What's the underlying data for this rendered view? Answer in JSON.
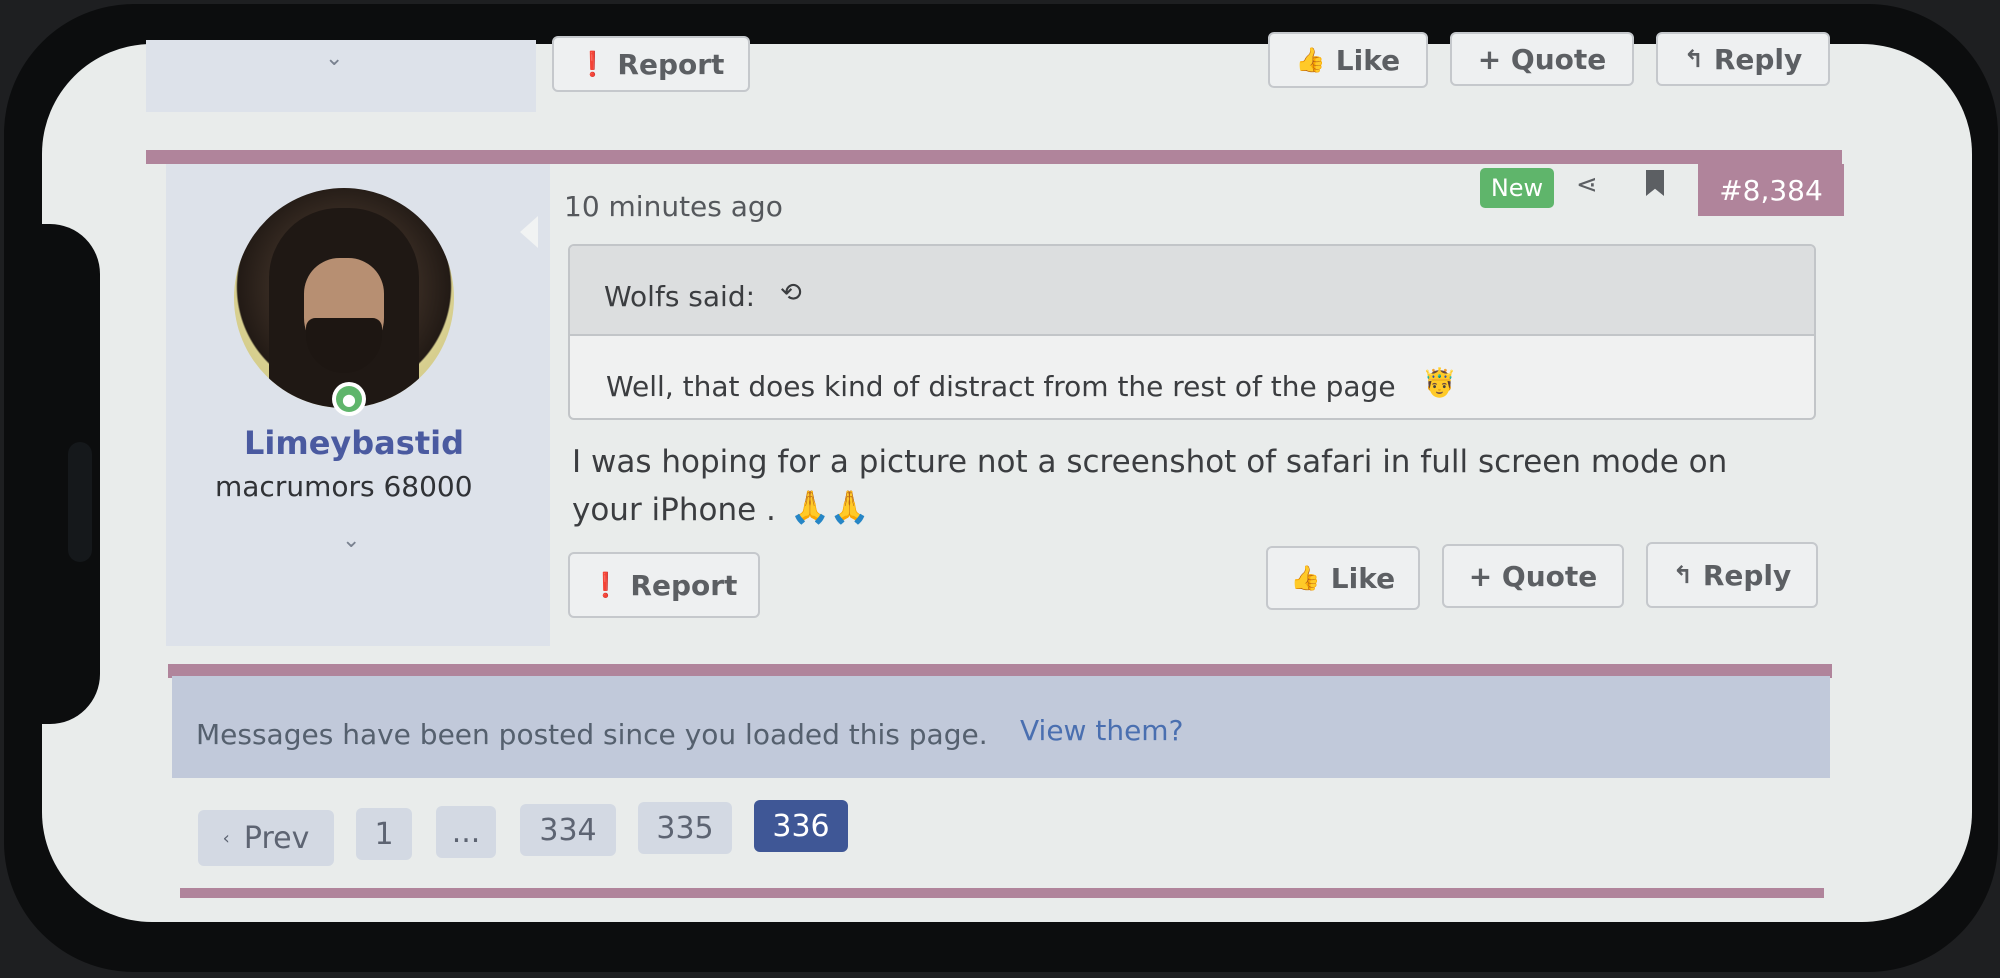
{
  "prev_post": {
    "report_label": "Report",
    "like_label": "Like",
    "quote_label": "+ Quote",
    "reply_label": "Reply"
  },
  "post": {
    "username": "Limeybastid",
    "user_title": "macrumors 68000",
    "timestamp": "10 minutes ago",
    "new_badge": "New",
    "post_number": "#8,384",
    "quote": {
      "author_line": "Wolfs said:",
      "text": "Well, that does kind of distract from the rest of the page",
      "emoji": "🤴"
    },
    "body_line1": "I was hoping for a picture not a screenshot of safari in full screen mode on",
    "body_line2": "your iPhone .",
    "body_emoji": "🙏🙏",
    "report_label": "Report",
    "like_label": "Like",
    "quote_label": "+ Quote",
    "reply_label": "Reply"
  },
  "notice": {
    "text": "Messages have been posted since you loaded this page.",
    "link": "View them?"
  },
  "pagination": {
    "prev_label": "Prev",
    "pages": [
      "1",
      "...",
      "334",
      "335",
      "336"
    ],
    "current": "336"
  },
  "colors": {
    "accent_pink": "#b0849b",
    "new_badge": "#5fb56b",
    "username": "#4a5aa0",
    "link": "#4a6fb0",
    "active_page": "#3f5796"
  },
  "icons": {
    "report": "exclamation-circle-icon",
    "like": "thumbs-up-icon",
    "reply": "reply-arrow-icon",
    "share": "share-icon",
    "bookmark": "bookmark-icon",
    "chevron": "chevron-down-icon",
    "quote_jump": "jump-to-quote-icon",
    "online": "online-status-icon"
  }
}
